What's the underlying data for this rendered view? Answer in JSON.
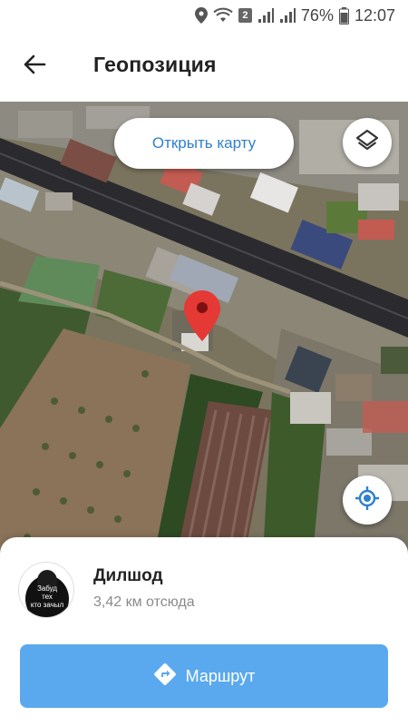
{
  "status_bar": {
    "badge": "2",
    "battery": "76%",
    "time": "12:07",
    "icons": [
      "location-icon",
      "wifi-icon",
      "sim-badge",
      "signal-icon",
      "signal-icon",
      "battery-icon"
    ]
  },
  "header": {
    "back_icon": "arrow-left-icon",
    "title": "Геопозиция"
  },
  "map": {
    "open_map_label": "Открыть карту",
    "layers_icon": "layers-icon",
    "locate_icon": "my-location-icon",
    "pin_icon": "map-pin-icon",
    "pin_color": "#e53935"
  },
  "contact": {
    "avatar_text": [
      "Забуд",
      "тех",
      "кто зачыл"
    ],
    "name": "Дилшод",
    "distance": "3,42 км отсюда"
  },
  "route": {
    "label": "Маршрут",
    "icon": "directions-icon",
    "color": "#5aa9ee"
  },
  "colors": {
    "accent": "#2f7fcf",
    "title": "#222222",
    "secondary_text": "#8a8a8a"
  }
}
